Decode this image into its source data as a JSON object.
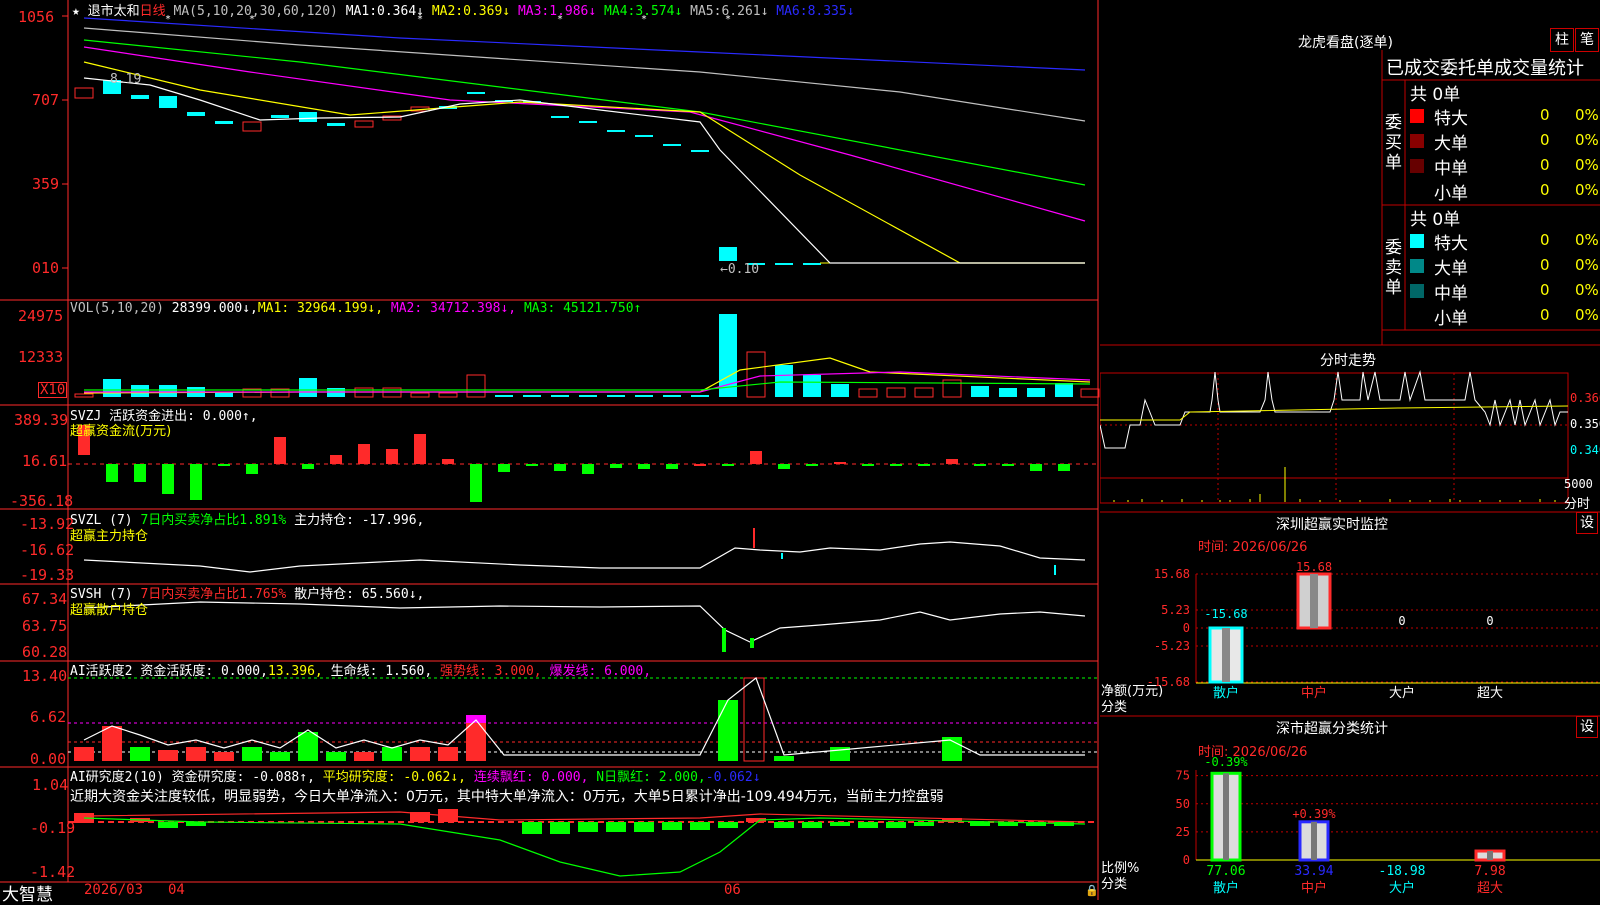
{
  "colors": {
    "up": "#ff2a2a",
    "down": "#00ffff",
    "green": "#00ff00",
    "yellow": "#ffff00",
    "magenta": "#ff00ff",
    "white": "#ffffff",
    "blue": "#2a2aff",
    "gray": "#c0c0c0",
    "red_border": "#c00000"
  },
  "header": {
    "star": "★",
    "stock_name": "退市太和",
    "period": "日线",
    "ma_label": "MA(5,10,20,30,60,120)",
    "mas": [
      {
        "name": "MA1:",
        "value": "0.364↓"
      },
      {
        "name": "MA2:",
        "value": "0.369↓"
      },
      {
        "name": "MA3:",
        "value": "1.986↓"
      },
      {
        "name": "MA4:",
        "value": "3.574↓"
      },
      {
        "name": "MA5:",
        "value": "6.261↓"
      },
      {
        "name": "MA6:",
        "value": "8.335↓"
      }
    ]
  },
  "price_panel": {
    "y_ticks": [
      "1056",
      "707",
      "359",
      "010"
    ],
    "high_label": "8.19",
    "low_label": "←0.10"
  },
  "vol_panel": {
    "title": "VOL(5,10,20)",
    "value": "28399.000↓,",
    "ma1": "MA1: 32964.199↓,",
    "ma2": "MA2: 34712.398↓,",
    "ma3": "MA3: 45121.750↑",
    "y_ticks": [
      "24975",
      "12333"
    ],
    "unit_badge": "X10"
  },
  "svzj_panel": {
    "line1": "SVZJ  活跃资金进出: 0.000↑,",
    "line2": "超赢资金流(万元)",
    "y_ticks": [
      "389.39",
      "16.61",
      "-356.18"
    ]
  },
  "svzl_panel": {
    "title": "SVZL (7)",
    "stat": "7日内买卖净占比1.891%",
    "rest": "主力持仓: -17.996,",
    "line2": "超赢主力持仓",
    "y_ticks": [
      "-13.92",
      "-16.62",
      "-19.33"
    ]
  },
  "svsh_panel": {
    "title": "SVSH (7)",
    "stat": "7日内买卖净占比1.765%",
    "rest": "散户持仓: 65.560↓,",
    "line2": "超赢散户持仓",
    "y_ticks": [
      "67.34",
      "63.75",
      "60.28"
    ]
  },
  "ai2_panel": {
    "title": "AI活跃度2",
    "t1": "资金活跃度: 0.000,",
    "t2": "13.396,",
    "t3": "生命线: 1.560,",
    "t4": "强势线: 3.000,",
    "t5": "爆发线: 6.000,",
    "y_ticks": [
      "13.40",
      "6.62",
      "0.00"
    ]
  },
  "ai_research_panel": {
    "title": "AI研究度2(10)",
    "t1": "资金研究度: -0.088↑,",
    "t2": "平均研究度: -0.062↓,",
    "t3": "连续飘红: 0.000,",
    "t4": "N日飘红: 2.000,",
    "t5": "-0.062↓",
    "comment": "近期大资金关注度较低，明显弱势，今日大单净流入：0万元，其中特大单净流入：0万元，大单5日累计净出-109.494万元，当前主力控盘弱",
    "y_ticks": [
      "1.04",
      "-0.19",
      "-1.42"
    ]
  },
  "footer": {
    "brand": "大智慧",
    "dates": [
      "2026/03",
      "04",
      "06"
    ]
  },
  "dragon": {
    "title": "龙虎看盘(逐单)",
    "btn_bar": "柱",
    "btn_brush": "笔",
    "subtitle": "已成交委托单成交量统计",
    "buy": {
      "side": "委买单",
      "total": "共 0单",
      "rows": [
        {
          "label": "特大",
          "count": "0",
          "pct": "0%"
        },
        {
          "label": "大单",
          "count": "0",
          "pct": "0%"
        },
        {
          "label": "中单",
          "count": "0",
          "pct": "0%"
        },
        {
          "label": "小单",
          "count": "0",
          "pct": "0%"
        }
      ]
    },
    "sell": {
      "side": "委卖单",
      "total": "共 0单",
      "rows": [
        {
          "label": "特大",
          "count": "0",
          "pct": "0%"
        },
        {
          "label": "大单",
          "count": "0",
          "pct": "0%"
        },
        {
          "label": "中单",
          "count": "0",
          "pct": "0%"
        },
        {
          "label": "小单",
          "count": "0",
          "pct": "0%"
        }
      ]
    }
  },
  "intraday": {
    "title": "分时走势",
    "y_ticks": [
      "0.360",
      "0.350",
      "0.340"
    ],
    "vol_tick": "5000",
    "vol_unit": "分时"
  },
  "sz_monitor": {
    "title": "深圳超赢实时监控",
    "btn": "设",
    "time": "时间: 2026/06/26",
    "y_ticks": [
      "15.68",
      "5.23",
      "0",
      "-5.23",
      "-15.68"
    ],
    "ylabel": "净额(万元)",
    "xlabel": "分类",
    "categories": [
      "散户",
      "中户",
      "大户",
      "超大"
    ],
    "values": [
      -15.68,
      15.68,
      0,
      0
    ],
    "value_labels": [
      "-15.68",
      "15.68",
      "0",
      "0"
    ]
  },
  "sz_class": {
    "title": "深市超赢分类统计",
    "btn": "设",
    "time": "时间: 2026/06/26",
    "y_ticks": [
      "75",
      "50",
      "25",
      "0"
    ],
    "ylabel": "比例%",
    "xlabel": "分类",
    "categories": [
      "散户",
      "中户",
      "大户",
      "超大"
    ],
    "values": [
      77.06,
      33.94,
      -18.98,
      7.98
    ],
    "top_labels": [
      "-0.39%",
      "+0.39%"
    ],
    "value_labels": [
      "77.06",
      "33.94",
      "-18.98",
      "7.98"
    ]
  }
}
